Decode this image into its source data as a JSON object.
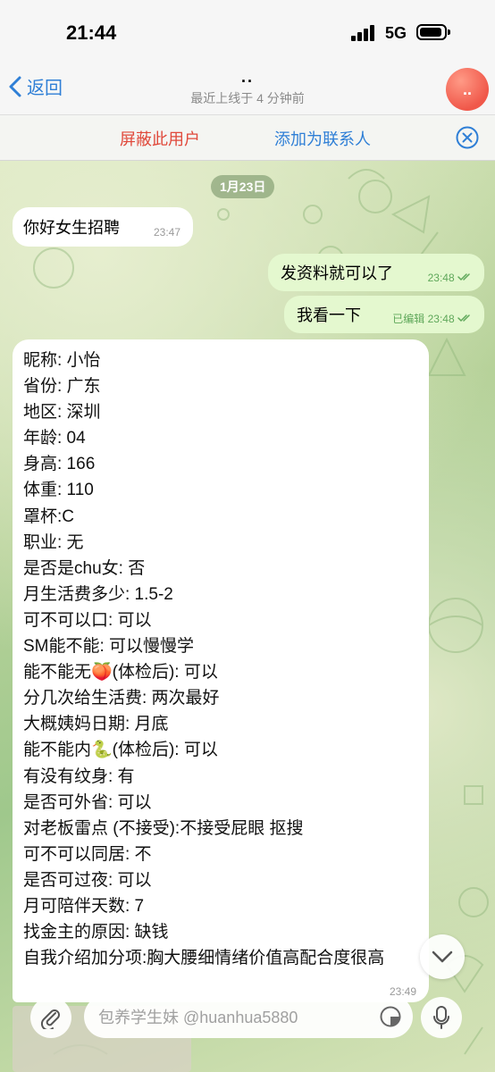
{
  "status_bar": {
    "time": "21:44",
    "network": "5G"
  },
  "header": {
    "back_label": "返回",
    "title": "..",
    "subtitle": "最近上线于 4 分钟前",
    "avatar_text": "..",
    "avatar_color": "#f0584a"
  },
  "action_bar": {
    "block_label": "屏蔽此用户",
    "add_label": "添加为联系人"
  },
  "date_divider": "1月23日",
  "messages": [
    {
      "text": "你好女生招聘",
      "time": "23:47"
    },
    {
      "text": "发资料就可以了",
      "time": "23:48"
    },
    {
      "text": "我看一下",
      "edited": "已编辑",
      "time": "23:48"
    }
  ],
  "profile_message": {
    "lines": [
      "昵称: 小怡",
      "省份: 广东",
      "地区: 深圳",
      "年龄: 04",
      "身高: 166",
      "体重: 110",
      "罩杯:C",
      "职业: 无",
      "是否是chu女: 否",
      "月生活费多少: 1.5-2",
      "可不可以口: 可以",
      "SM能不能: 可以慢慢学",
      "能不能无🍑(体检后): 可以",
      "分几次给生活费: 两次最好",
      "大概姨妈日期: 月底",
      "能不能内🐍(体检后): 可以",
      "有没有纹身: 有",
      "是否可外省: 可以",
      "对老板雷点 (不接受):不接受屁眼 抠搜",
      "可不可以同居: 不",
      "是否可过夜: 可以",
      "月可陪伴天数: 7",
      "找金主的原因: 缺钱"
    ],
    "last_line": "自我介绍加分项:胸大腰细情绪价值高配合度很高",
    "time": "23:49"
  },
  "composer": {
    "placeholder": "包养学生妹 @huanhua5880"
  },
  "colors": {
    "accent": "#2f7fd6",
    "danger": "#e0493b",
    "outgoing_bubble": "#e4f8cf",
    "read_check": "#5fa85a"
  }
}
